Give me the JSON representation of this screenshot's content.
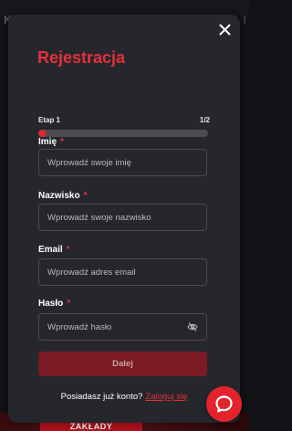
{
  "background": {
    "letter_left": "K",
    "letter_right": "I",
    "banner_button": "ZAKŁADY"
  },
  "modal": {
    "title": "Rejestracja",
    "step_label": "Etap 1",
    "step_count": "1/2",
    "progress_fraction": 0.05,
    "fields": {
      "first_name": {
        "label": "Imię",
        "required_mark": "*",
        "placeholder": "Wprowadź swoje imię",
        "value": ""
      },
      "last_name": {
        "label": "Nazwisko",
        "required_mark": "*",
        "placeholder": "Wprowadź swoje nazwisko",
        "value": ""
      },
      "email": {
        "label": "Email",
        "required_mark": "*",
        "placeholder": "Wprowadź adres email",
        "value": ""
      },
      "password": {
        "label": "Hasło",
        "required_mark": "*",
        "placeholder": "Wprowadź hasło",
        "value": ""
      }
    },
    "next_button": "Dalej",
    "login_prompt": "Posiadasz już konto?",
    "login_link": "Zaloguj się"
  },
  "icons": {
    "close": "close-icon",
    "password_toggle": "eye-off-icon",
    "chat": "chat-bubble-icon"
  },
  "colors": {
    "accent": "#e5303b",
    "modal_bg": "#26272c",
    "next_button_bg": "#7a1a22",
    "chat_button_bg": "#e4232d"
  }
}
